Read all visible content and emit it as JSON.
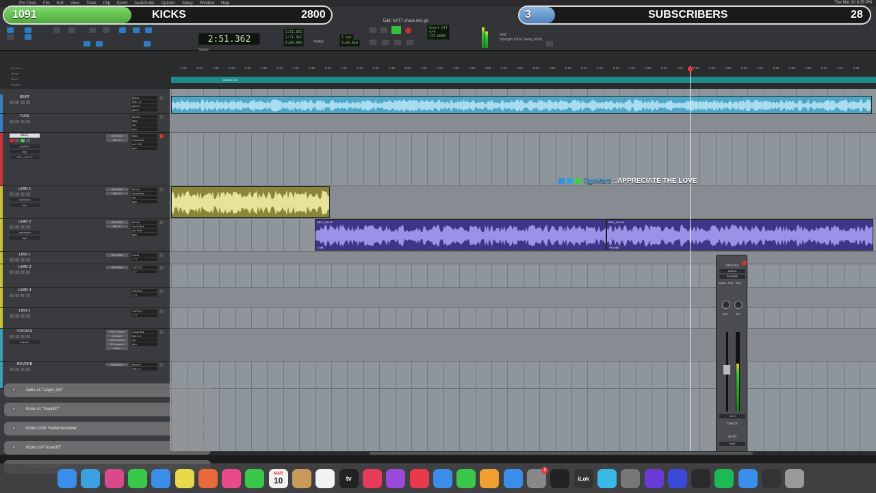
{
  "menubar": {
    "items": [
      "Pro Tools",
      "File",
      "Edit",
      "View",
      "Track",
      "Clip",
      "Event",
      "AudioSuite",
      "Options",
      "Setup",
      "Window",
      "Help"
    ],
    "clock": "Tue Mar 10  8:35 PM"
  },
  "overlay": {
    "left_count": "1091",
    "left_label": "KICKS",
    "left_goal": "2800",
    "right_count": "3",
    "right_label": "SUBSCRIBERS",
    "right_goal": "28"
  },
  "toolbar": {
    "edit_title": "Edit: NATT chase lets go",
    "main_counter": "2:51.362",
    "sub_counter_start": "2:51.362",
    "sub_counter_end": "2:51.362",
    "sub_counter_length": "0:00.000",
    "nudge": "0:00.010",
    "cursor_label": "Cursor",
    "grid_label": "Grid",
    "grid_value": "1 bar",
    "nudge_label": "Nudge",
    "countoff": "Count Off",
    "meter": "Meter",
    "tempo": "Tempo",
    "meter_value": "4/4",
    "tempo_value": "117.0000",
    "strength_label": "Strength",
    "strength_value": "100%",
    "swing_label": "Swing",
    "swing_value": "100%"
  },
  "rulers": {
    "names": [
      "Min:Secs",
      "Tempo",
      "Meter",
      "Markers"
    ],
    "tempo_text": "Default: 4/4",
    "ticks": [
      "1:22",
      "1:24",
      "1:26",
      "1:28",
      "1:30",
      "1:32",
      "1:34",
      "1:36",
      "1:38",
      "1:40",
      "1:42",
      "1:44",
      "1:46",
      "1:48",
      "1:50",
      "1:52",
      "1:54",
      "1:56",
      "1:58",
      "2:00",
      "2:02",
      "2:04",
      "2:06",
      "2:08",
      "2:10",
      "2:12",
      "2:14",
      "2:16",
      "2:18",
      "2:20",
      "2:22",
      "2:24",
      "2:26",
      "2:28",
      "2:30",
      "2:32",
      "2:34",
      "2:36",
      "2:38",
      "2:40",
      "2:42",
      "2:44",
      "2:46"
    ]
  },
  "columns": [
    "INSERTS A-E",
    "INSERTS F-J",
    "SENDS A-E",
    "I / O"
  ],
  "tracks": [
    {
      "name": "BEAT",
      "color": "#3a7fc4",
      "io": [
        "Mono",
        "Out 1-2",
        "vol 0.0",
        "pan 0"
      ],
      "inserts": []
    },
    {
      "name": "TUNE",
      "color": "#3a7fc4",
      "io": [
        "MOLH",
        "REC",
        "vol",
        "pan"
      ],
      "inserts": []
    },
    {
      "name": "REC",
      "color": "#c8343a",
      "io": [
        "REC",
        "Vocal Bus",
        "vol +5.8",
        "pan"
      ],
      "inserts": [
        "REVERB",
        "DELAY"
      ],
      "sub": [
        "playlists",
        "dyn",
        "REC_187-03"
      ]
    },
    {
      "name": "LEAD 1",
      "color": "#c8c23a",
      "io": [
        "MOLH",
        "Vocal Bus",
        "vol",
        "pan"
      ],
      "inserts": [
        "REVERB",
        "DELAY"
      ],
      "sub": [
        "waveform",
        "dyn"
      ]
    },
    {
      "name": "LEAD 2",
      "color": "#c8c23a",
      "io": [
        "MOLH",
        "Vocal Bus",
        "vol +8.8",
        "pan"
      ],
      "inserts": [
        "REVERB",
        "DELAY"
      ],
      "sub": [
        "waveform",
        "dyn"
      ]
    },
    {
      "name": "LIBS 1",
      "color": "#c8c23a",
      "io": [
        "Vocal",
        "-7.3"
      ],
      "inserts": [
        "REVERB"
      ]
    },
    {
      "name": "LEAD 3",
      "color": "#c8c23a",
      "io": [
        "VIRTUO",
        "-6.7"
      ],
      "inserts": [
        "REVERB"
      ]
    },
    {
      "name": "LEAD 4",
      "color": "#c8c23a",
      "io": [
        "VIRTUO",
        "-7.3"
      ],
      "inserts": []
    },
    {
      "name": "LIBS 2",
      "color": "#c8c23a",
      "io": [
        "VIRTUO",
        "-7.3"
      ],
      "inserts": []
    },
    {
      "name": "VOCALS",
      "color": "#3a9fb0",
      "io": [
        "Vocal Bus",
        "Out 1-2",
        "vol",
        "pan"
      ],
      "inserts": [
        "PRO-T-Band",
        "DeEsser",
        "SSLChannel",
        "RCompres",
        "RVox"
      ],
      "sub": [
        "volume"
      ]
    },
    {
      "name": "REVERB",
      "color": "#3a9fb0",
      "io": [
        "Reverb",
        "Out 1-2"
      ],
      "inserts": [
        "MangVerb"
      ]
    }
  ],
  "clips": {
    "beat_name": "BEAT",
    "lead1_name": "LEAD 1",
    "lead2_a_name": "REC_180-01",
    "lead2_a_foot": "1 dB",
    "lead2_b_name": "REC_121-01",
    "lead2_b_foot": "+4.4 dB"
  },
  "chat": {
    "user": "TigoMarz",
    "message": ": APPRECIATE THE LOVE"
  },
  "mini_strip": {
    "name": "VOCALS",
    "slots": [
      "send a",
      "REVERB"
    ],
    "sends": [
      "SAFE",
      "PRE",
      "FMP"
    ],
    "values": [
      "-100",
      "100"
    ],
    "level": "-12.9",
    "level_fill": 0.6,
    "track": "TRACK",
    "auto": "AUTO",
    "mode": "read"
  },
  "alerts": [
    {
      "text": "Subs x1 \"Lloyd_strr\""
    },
    {
      "text": "Kicks x1 \"kcain97\""
    },
    {
      "text": "Kicks x100 \"Naiturneronline\""
    },
    {
      "text": "Kicks x10 \"kcain97\""
    },
    {
      "text": "Kicks x10 \"kcain97\""
    }
  ],
  "dock": {
    "calendar_day": "10",
    "calendar_month": "MAR",
    "settings_badge": "2",
    "appletv": "tv",
    "ilok": "iLok"
  }
}
